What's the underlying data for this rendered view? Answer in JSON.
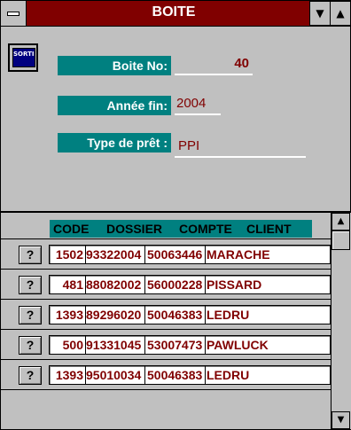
{
  "window": {
    "title": "BOITE",
    "sysmenu_icon": "system-menu-icon",
    "minimize_glyph": "▼",
    "maximize_glyph": "▲"
  },
  "form": {
    "sortie_label": "SORTIE",
    "boite_no_label": "Boite No:",
    "boite_no_value": "40",
    "annee_fin_label": "Année fin:",
    "annee_fin_value": "2004",
    "type_pret_label": "Type de prêt :",
    "type_pret_value": "PPI"
  },
  "table": {
    "headers": [
      "CODE",
      "DOSSIER",
      "COMPTE",
      "CLIENT"
    ],
    "row_button_label": "?",
    "rows": [
      {
        "code": "1502",
        "dossier": "93322004",
        "compte": "50063446",
        "client": "MARACHE"
      },
      {
        "code": "481",
        "dossier": "88082002",
        "compte": "56000228",
        "client": "PISSARD"
      },
      {
        "code": "1393",
        "dossier": "89296020",
        "compte": "50046383",
        "client": "LEDRU"
      },
      {
        "code": "500",
        "dossier": "91331045",
        "compte": "53007473",
        "client": "PAWLUCK"
      },
      {
        "code": "1393",
        "dossier": "95010034",
        "compte": "50046383",
        "client": "LEDRU"
      }
    ]
  },
  "scrollbar": {
    "up_glyph": "▲",
    "down_glyph": "▼"
  },
  "colors": {
    "title_bar": "#800000",
    "label_bg": "#008080",
    "value_text": "#800000",
    "window_bg": "#c0c0c0"
  }
}
